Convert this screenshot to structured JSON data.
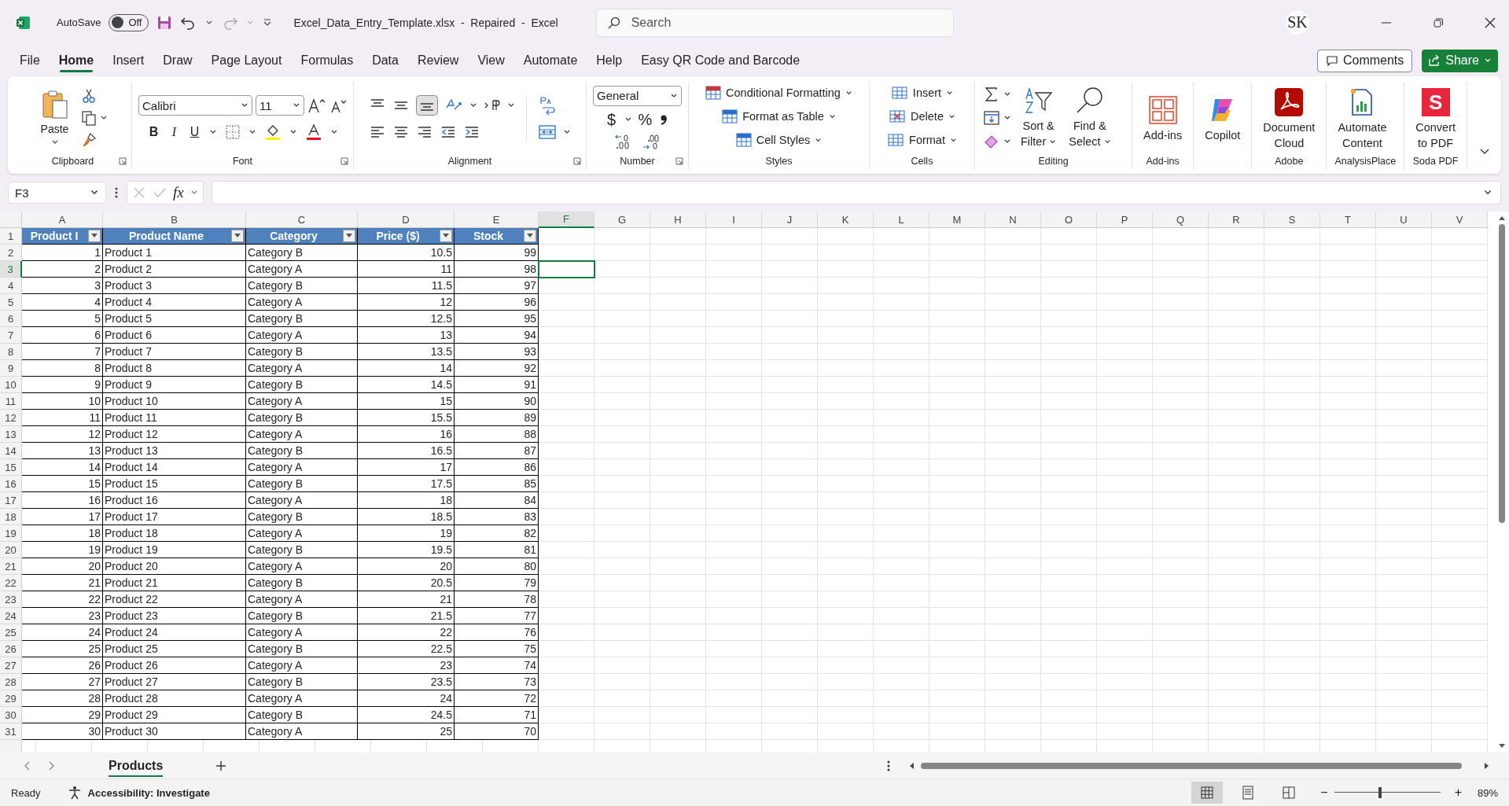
{
  "title_bar": {
    "autosave_label": "AutoSave",
    "autosave": {
      "label": "Off",
      "on": false
    },
    "title": "Excel_Data_Entry_Template.xlsx  -  Repaired  -  Excel",
    "search": {
      "placeholder": "Search"
    },
    "avatar": "SK"
  },
  "menu_tabs": [
    {
      "label": "File",
      "selected": false
    },
    {
      "label": "Home",
      "selected": true
    },
    {
      "label": "Insert",
      "selected": false
    },
    {
      "label": "Draw",
      "selected": false
    },
    {
      "label": "Page Layout",
      "selected": false
    },
    {
      "label": "Formulas",
      "selected": false
    },
    {
      "label": "Data",
      "selected": false
    },
    {
      "label": "Review",
      "selected": false
    },
    {
      "label": "View",
      "selected": false
    },
    {
      "label": "Automate",
      "selected": false
    },
    {
      "label": "Help",
      "selected": false
    },
    {
      "label": "Easy QR Code and Barcode",
      "selected": false
    }
  ],
  "header_buttons": {
    "comments": "Comments",
    "share": "Share"
  },
  "ribbon": {
    "clipboard": {
      "label": "Clipboard",
      "paste": "Paste"
    },
    "font": {
      "label": "Font",
      "font_name": "Calibri",
      "font_size": "11",
      "bold": "B",
      "italic": "I",
      "underline": "U"
    },
    "alignment": {
      "label": "Alignment"
    },
    "number": {
      "label": "Number",
      "format": "General",
      "currency": "$",
      "percent": "%"
    },
    "styles": {
      "label": "Styles",
      "buttons": [
        "Conditional Formatting",
        "Format as Table",
        "Cell Styles"
      ]
    },
    "cells": {
      "label": "Cells",
      "buttons": [
        "Insert",
        "Delete",
        "Format"
      ]
    },
    "editing": {
      "label": "Editing",
      "sort": [
        "Sort &",
        "Filter"
      ],
      "find": [
        "Find &",
        "Select"
      ]
    },
    "big_groups": [
      {
        "label": "Add-ins",
        "buttons": [
          {
            "kind": "addins",
            "lines": [
              "Add-ins"
            ]
          }
        ]
      },
      {
        "buttons": [
          {
            "kind": "copilot",
            "lines": [
              "Copilot"
            ]
          }
        ]
      },
      {
        "label": "Adobe",
        "buttons": [
          {
            "kind": "adobe",
            "lines": [
              "Document",
              "Cloud"
            ]
          }
        ]
      },
      {
        "label": "AnalysisPlace",
        "buttons": [
          {
            "kind": "automate",
            "lines": [
              "Automate",
              "Content"
            ]
          }
        ]
      },
      {
        "label": "Soda PDF",
        "buttons": [
          {
            "kind": "soda",
            "logo": "S",
            "lines": [
              "Convert",
              "to PDF"
            ]
          }
        ]
      }
    ]
  },
  "formula_bar": {
    "name_box": "F3",
    "fx": "fx"
  },
  "sheet": {
    "columns": [
      {
        "label": "A",
        "selected": false
      },
      {
        "label": "B",
        "selected": false
      },
      {
        "label": "C",
        "selected": false
      },
      {
        "label": "D",
        "selected": false
      },
      {
        "label": "E",
        "selected": false
      },
      {
        "label": "F",
        "selected": true
      },
      {
        "label": "G",
        "selected": false
      },
      {
        "label": "H",
        "selected": false
      },
      {
        "label": "I",
        "selected": false
      },
      {
        "label": "J",
        "selected": false
      },
      {
        "label": "K",
        "selected": false
      },
      {
        "label": "L",
        "selected": false
      },
      {
        "label": "M",
        "selected": false
      },
      {
        "label": "N",
        "selected": false
      },
      {
        "label": "O",
        "selected": false
      },
      {
        "label": "P",
        "selected": false
      },
      {
        "label": "Q",
        "selected": false
      },
      {
        "label": "R",
        "selected": false
      },
      {
        "label": "S",
        "selected": false
      },
      {
        "label": "T",
        "selected": false
      },
      {
        "label": "U",
        "selected": false
      },
      {
        "label": "V",
        "selected": false
      }
    ],
    "row_numbers": [
      {
        "label": "1",
        "selected": false
      },
      {
        "label": "2",
        "selected": false
      },
      {
        "label": "3",
        "selected": true
      },
      {
        "label": "4",
        "selected": false
      },
      {
        "label": "5",
        "selected": false
      },
      {
        "label": "6",
        "selected": false
      },
      {
        "label": "7",
        "selected": false
      },
      {
        "label": "8",
        "selected": false
      },
      {
        "label": "9",
        "selected": false
      },
      {
        "label": "10",
        "selected": false
      },
      {
        "label": "11",
        "selected": false
      },
      {
        "label": "12",
        "selected": false
      },
      {
        "label": "13",
        "selected": false
      },
      {
        "label": "14",
        "selected": false
      },
      {
        "label": "15",
        "selected": false
      },
      {
        "label": "16",
        "selected": false
      },
      {
        "label": "17",
        "selected": false
      },
      {
        "label": "18",
        "selected": false
      },
      {
        "label": "19",
        "selected": false
      },
      {
        "label": "20",
        "selected": false
      },
      {
        "label": "21",
        "selected": false
      },
      {
        "label": "22",
        "selected": false
      },
      {
        "label": "23",
        "selected": false
      },
      {
        "label": "24",
        "selected": false
      },
      {
        "label": "25",
        "selected": false
      },
      {
        "label": "26",
        "selected": false
      },
      {
        "label": "27",
        "selected": false
      },
      {
        "label": "28",
        "selected": false
      },
      {
        "label": "29",
        "selected": false
      },
      {
        "label": "30",
        "selected": false
      },
      {
        "label": "31",
        "selected": false
      }
    ],
    "table": {
      "columns": [
        {
          "label": "Product I",
          "kind": "number"
        },
        {
          "label": "Product Name",
          "kind": "text"
        },
        {
          "label": "Category",
          "kind": "text"
        },
        {
          "label": "Price ($)",
          "kind": "number"
        },
        {
          "label": "Stock",
          "kind": "number"
        }
      ],
      "rows": [
        [
          "1",
          "Product 1",
          "Category B",
          "10.5",
          "99"
        ],
        [
          "2",
          "Product 2",
          "Category A",
          "11",
          "98"
        ],
        [
          "3",
          "Product 3",
          "Category B",
          "11.5",
          "97"
        ],
        [
          "4",
          "Product 4",
          "Category A",
          "12",
          "96"
        ],
        [
          "5",
          "Product 5",
          "Category B",
          "12.5",
          "95"
        ],
        [
          "6",
          "Product 6",
          "Category A",
          "13",
          "94"
        ],
        [
          "7",
          "Product 7",
          "Category B",
          "13.5",
          "93"
        ],
        [
          "8",
          "Product 8",
          "Category A",
          "14",
          "92"
        ],
        [
          "9",
          "Product 9",
          "Category B",
          "14.5",
          "91"
        ],
        [
          "10",
          "Product 10",
          "Category A",
          "15",
          "90"
        ],
        [
          "11",
          "Product 11",
          "Category B",
          "15.5",
          "89"
        ],
        [
          "12",
          "Product 12",
          "Category A",
          "16",
          "88"
        ],
        [
          "13",
          "Product 13",
          "Category B",
          "16.5",
          "87"
        ],
        [
          "14",
          "Product 14",
          "Category A",
          "17",
          "86"
        ],
        [
          "15",
          "Product 15",
          "Category B",
          "17.5",
          "85"
        ],
        [
          "16",
          "Product 16",
          "Category A",
          "18",
          "84"
        ],
        [
          "17",
          "Product 17",
          "Category B",
          "18.5",
          "83"
        ],
        [
          "18",
          "Product 18",
          "Category A",
          "19",
          "82"
        ],
        [
          "19",
          "Product 19",
          "Category B",
          "19.5",
          "81"
        ],
        [
          "20",
          "Product 20",
          "Category A",
          "20",
          "80"
        ],
        [
          "21",
          "Product 21",
          "Category B",
          "20.5",
          "79"
        ],
        [
          "22",
          "Product 22",
          "Category A",
          "21",
          "78"
        ],
        [
          "23",
          "Product 23",
          "Category B",
          "21.5",
          "77"
        ],
        [
          "24",
          "Product 24",
          "Category A",
          "22",
          "76"
        ],
        [
          "25",
          "Product 25",
          "Category B",
          "22.5",
          "75"
        ],
        [
          "26",
          "Product 26",
          "Category A",
          "23",
          "74"
        ],
        [
          "27",
          "Product 27",
          "Category B",
          "23.5",
          "73"
        ],
        [
          "28",
          "Product 28",
          "Category A",
          "24",
          "72"
        ],
        [
          "29",
          "Product 29",
          "Category B",
          "24.5",
          "71"
        ],
        [
          "30",
          "Product 30",
          "Category A",
          "25",
          "70"
        ]
      ]
    }
  },
  "sheet_tabs": [
    {
      "label": "Products",
      "selected": true
    }
  ],
  "status_bar": {
    "ready": "Ready",
    "accessibility": "Accessibility: Investigate",
    "zoom_minus": "−",
    "zoom_plus": "+",
    "zoom_slider": {
      "level": 0.43
    },
    "zoom": "89%"
  }
}
